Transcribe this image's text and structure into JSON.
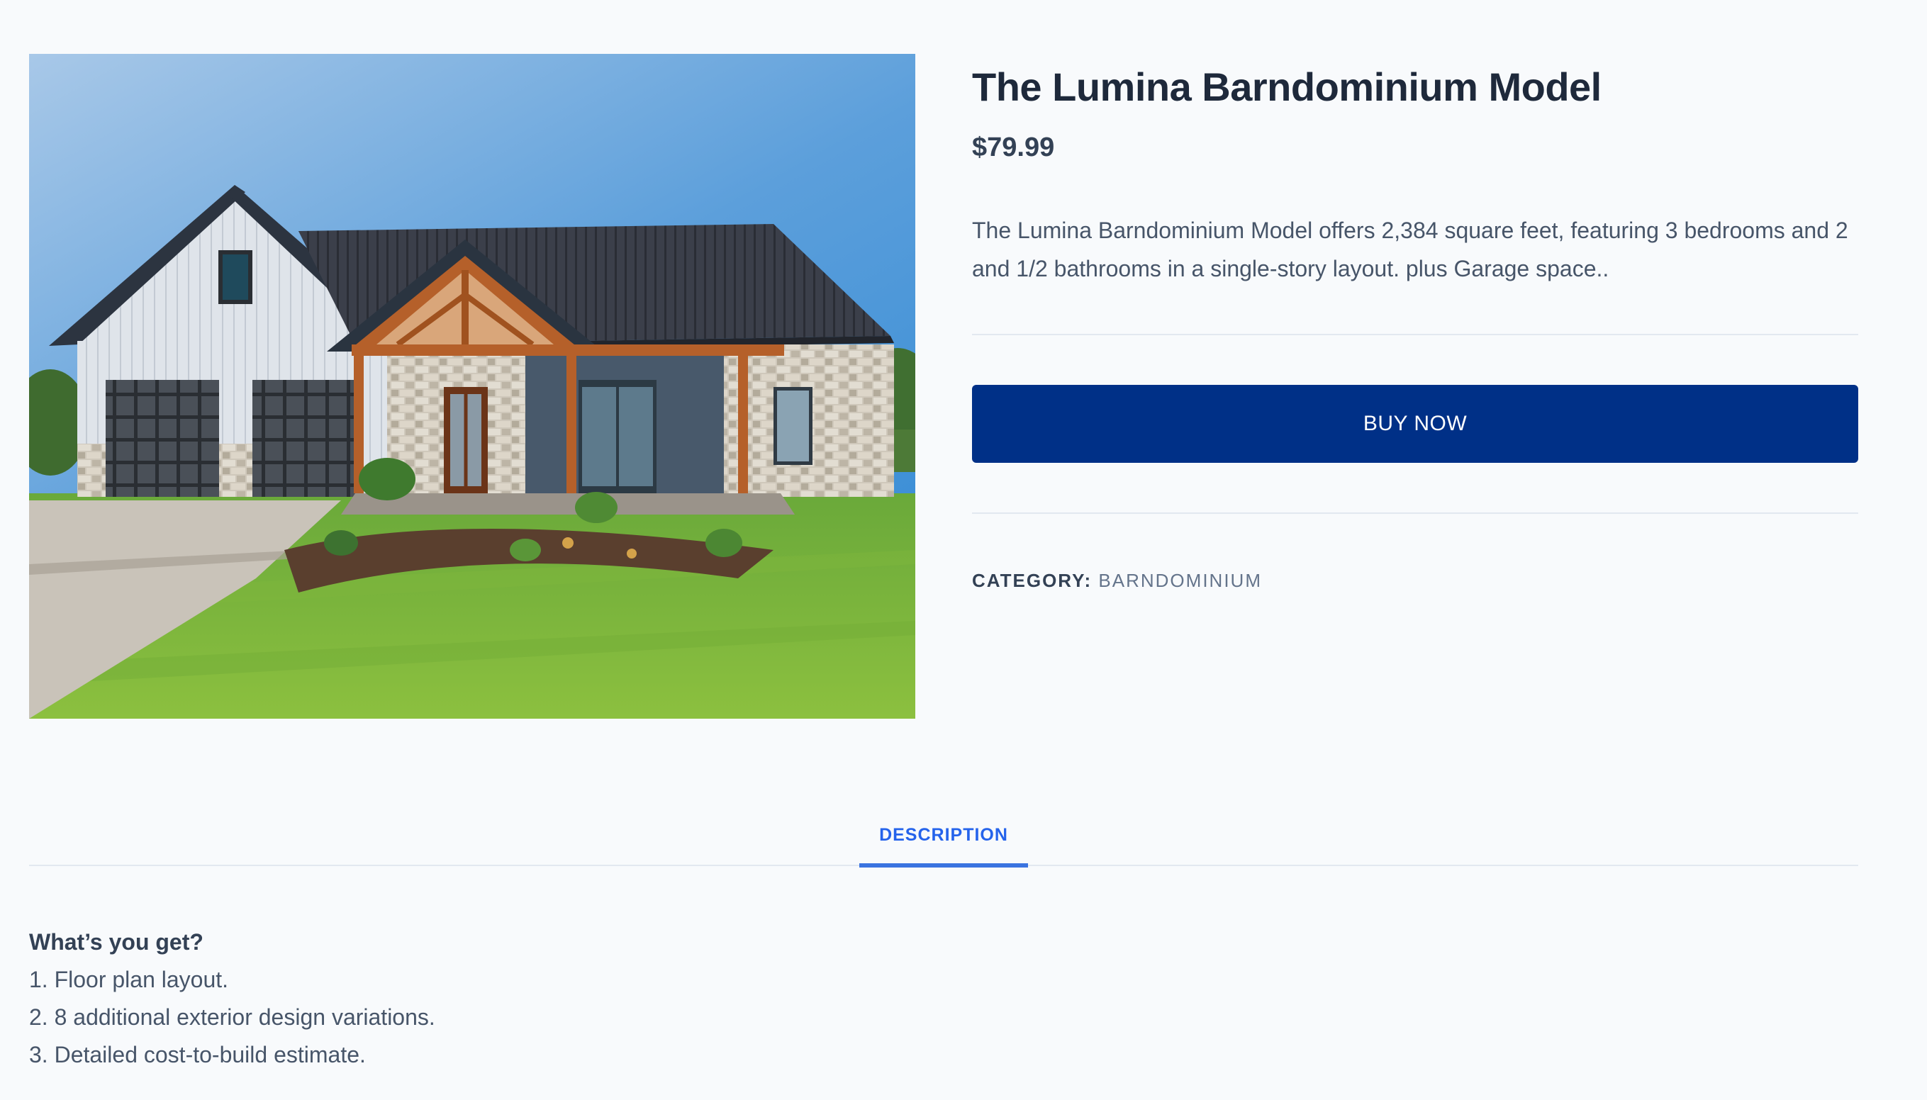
{
  "product": {
    "title": "The Lumina Barndominium Model",
    "price": "$79.99",
    "short_description": "The Lumina Barndominium Model offers 2,384 square feet, featuring 3 bedrooms and 2 and 1/2 bathrooms in a single-story layout. plus Garage space..",
    "buy_button_label": "BUY NOW",
    "category_label": "CATEGORY:",
    "category_value": "BARNDOMINIUM"
  },
  "tabs": {
    "items": [
      {
        "label": "DESCRIPTION",
        "active": true
      }
    ]
  },
  "description_panel": {
    "heading": "What’s you get?",
    "items": [
      "1. Floor plan layout.",
      "2. 8 additional exterior design variations.",
      "3. Detailed cost-to-build estimate."
    ]
  },
  "colors": {
    "page_background": "#f8fafc",
    "title": "#1e293b",
    "buy_button": "#003087",
    "tab_active": "#2563eb",
    "tab_underline": "#3b74e0",
    "divider": "#e2e8f0"
  }
}
